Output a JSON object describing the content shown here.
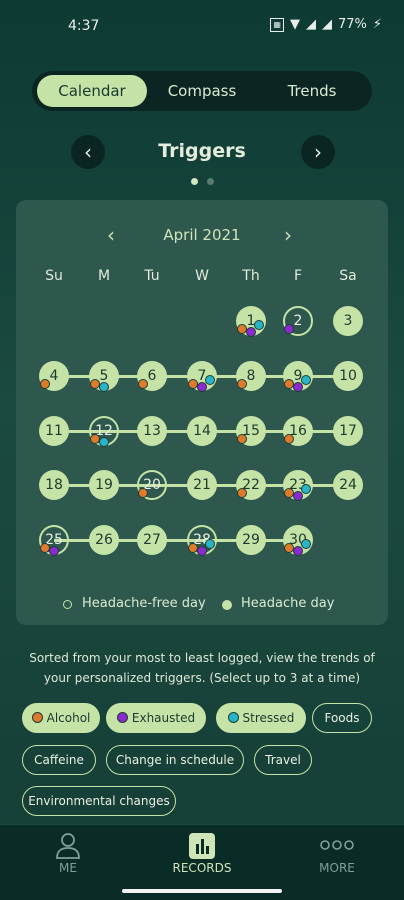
{
  "status_bar": {
    "time": "4:37",
    "battery": "77%"
  },
  "tabs": [
    {
      "label": "Calendar",
      "active": true
    },
    {
      "label": "Compass",
      "active": false
    },
    {
      "label": "Trends",
      "active": false
    }
  ],
  "section": {
    "title": "Triggers",
    "page": 1,
    "pages": 2
  },
  "calendar": {
    "month": "April 2021",
    "weekdays": [
      "Su",
      "M",
      "Tu",
      "W",
      "Th",
      "F",
      "Sa"
    ],
    "days": [
      {
        "d": "1",
        "headache": true,
        "triggers": [
          "alcohol",
          "exhausted",
          "stressed"
        ]
      },
      {
        "d": "2",
        "headache": false,
        "triggers": [
          "exhausted"
        ]
      },
      {
        "d": "3",
        "headache": true,
        "triggers": []
      },
      {
        "d": "4",
        "headache": true,
        "triggers": [
          "alcohol"
        ]
      },
      {
        "d": "5",
        "headache": true,
        "triggers": [
          "alcohol",
          "stressed"
        ]
      },
      {
        "d": "6",
        "headache": true,
        "triggers": [
          "alcohol"
        ]
      },
      {
        "d": "7",
        "headache": true,
        "triggers": [
          "alcohol",
          "exhausted",
          "stressed"
        ]
      },
      {
        "d": "8",
        "headache": true,
        "triggers": [
          "alcohol"
        ]
      },
      {
        "d": "9",
        "headache": true,
        "triggers": [
          "alcohol",
          "exhausted",
          "stressed"
        ]
      },
      {
        "d": "10",
        "headache": true,
        "triggers": []
      },
      {
        "d": "11",
        "headache": true,
        "triggers": []
      },
      {
        "d": "12",
        "headache": false,
        "triggers": [
          "alcohol",
          "stressed"
        ]
      },
      {
        "d": "13",
        "headache": true,
        "triggers": []
      },
      {
        "d": "14",
        "headache": true,
        "triggers": []
      },
      {
        "d": "15",
        "headache": true,
        "triggers": [
          "alcohol"
        ]
      },
      {
        "d": "16",
        "headache": true,
        "triggers": [
          "alcohol"
        ]
      },
      {
        "d": "17",
        "headache": true,
        "triggers": []
      },
      {
        "d": "18",
        "headache": true,
        "triggers": []
      },
      {
        "d": "19",
        "headache": true,
        "triggers": []
      },
      {
        "d": "20",
        "headache": false,
        "triggers": [
          "alcohol"
        ]
      },
      {
        "d": "21",
        "headache": true,
        "triggers": []
      },
      {
        "d": "22",
        "headache": true,
        "triggers": [
          "alcohol"
        ]
      },
      {
        "d": "23",
        "headache": true,
        "triggers": [
          "alcohol",
          "exhausted",
          "stressed"
        ]
      },
      {
        "d": "24",
        "headache": true,
        "triggers": []
      },
      {
        "d": "25",
        "headache": false,
        "triggers": [
          "alcohol",
          "exhausted"
        ]
      },
      {
        "d": "26",
        "headache": true,
        "triggers": []
      },
      {
        "d": "27",
        "headache": true,
        "triggers": []
      },
      {
        "d": "28",
        "headache": false,
        "triggers": [
          "alcohol",
          "exhausted",
          "stressed"
        ]
      },
      {
        "d": "29",
        "headache": true,
        "triggers": []
      },
      {
        "d": "30",
        "headache": true,
        "triggers": [
          "alcohol",
          "exhausted",
          "stressed"
        ]
      }
    ]
  },
  "legend": {
    "free": "Headache-free day",
    "headache": "Headache day"
  },
  "sort_text": "Sorted from your most to least logged, view the trends of your personalized triggers. (Select up to 3 at a time)",
  "chips": [
    {
      "label": "Alcohol",
      "selected": true,
      "color": "#e07a2b"
    },
    {
      "label": "Exhausted",
      "selected": true,
      "color": "#8a2ad0"
    },
    {
      "label": "Stressed",
      "selected": true,
      "color": "#27b4c8"
    },
    {
      "label": "Foods",
      "selected": false
    },
    {
      "label": "Caffeine",
      "selected": false
    },
    {
      "label": "Change in schedule",
      "selected": false
    },
    {
      "label": "Travel",
      "selected": false
    },
    {
      "label": "Environmental changes",
      "selected": false
    }
  ],
  "bottom_nav": [
    {
      "label": "ME",
      "icon": "person-icon",
      "active": false
    },
    {
      "label": "RECORDS",
      "icon": "bar-chart-icon",
      "active": true
    },
    {
      "label": "MORE",
      "icon": "more-dots-icon",
      "active": false
    }
  ],
  "colors": {
    "accent": "#c5e3a6",
    "alcohol": "#e07a2b",
    "exhausted": "#8a2ad0",
    "stressed": "#27b4c8"
  }
}
